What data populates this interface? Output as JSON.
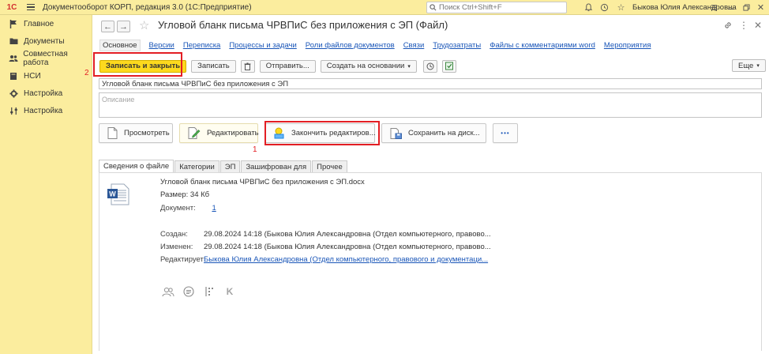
{
  "app": {
    "title": "Документооборот КОРП, редакция 3.0  (1С:Предприятие)",
    "logo_text": "1С",
    "search_placeholder": "Поиск Ctrl+Shift+F",
    "user": "Быкова Юлия Александровна"
  },
  "sidebar": {
    "items": [
      {
        "label": "Главное",
        "icon": "flag-icon"
      },
      {
        "label": "Документы",
        "icon": "folder-icon"
      },
      {
        "label": "Совместная работа",
        "icon": "users-icon"
      },
      {
        "label": "НСИ",
        "icon": "book-icon"
      },
      {
        "label": "Настройка",
        "icon": "gear-icon"
      },
      {
        "label": "Настройка",
        "icon": "sliders-icon"
      }
    ]
  },
  "document": {
    "title": "Угловой бланк письма ЧРВПиС без приложения с ЭП (Файл)",
    "tabs": [
      "Основное",
      "Версии",
      "Переписка",
      "Процессы и задачи",
      "Роли файлов документов",
      "Связи",
      "Трудозатраты",
      "Файлы с комментариями word",
      "Мероприятия"
    ],
    "toolbar": {
      "save_close": "Записать и закрыть",
      "save": "Записать",
      "send": "Отправить...",
      "create_based": "Создать на основании",
      "more": "Еще"
    },
    "name_value": "Угловой бланк письма ЧРВПиС без приложения с ЭП",
    "description_placeholder": "Описание",
    "actions": {
      "view": "Просмотреть",
      "edit": "Редактировать",
      "finish_edit": "Закончить редактиров...",
      "save_disk": "Сохранить на диск...",
      "more_dots": "•••"
    },
    "markers": {
      "one": "1",
      "two": "2"
    },
    "file_tabs": [
      "Сведения о файле",
      "Категории",
      "ЭП",
      "Зашифрован для",
      "Прочее"
    ],
    "file_info": {
      "file_name": "Угловой бланк письма ЧРВПиС без приложения с ЭП.docx",
      "size": "Размер: 34 Кб",
      "doc_label": "Документ:",
      "doc_value": "1",
      "created_label": "Создан:",
      "created_value": "29.08.2024 14:18 (Быкова Юлия Александровна (Отдел компьютерного, правово...",
      "modified_label": "Изменен:",
      "modified_value": "29.08.2024 14:18 (Быкова Юлия Александровна (Отдел компьютерного, правово...",
      "editing_label": "Редактирует:",
      "editing_value": "Быкова Юлия Александровна (Отдел компьютерного, правового и документаци..."
    }
  }
}
